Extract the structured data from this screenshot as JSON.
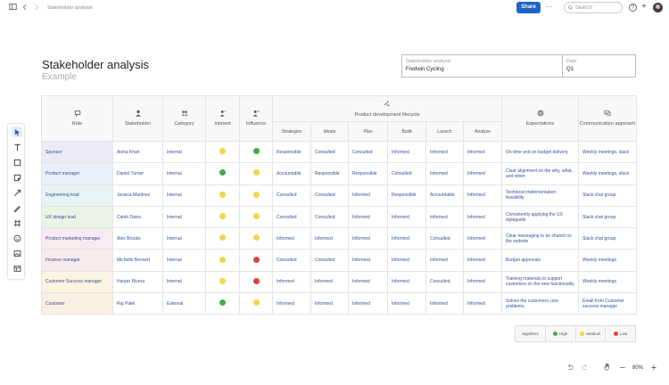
{
  "header": {
    "breadcrumb": "Stakeholder analysis",
    "share_label": "Share",
    "search_placeholder": "Search"
  },
  "document": {
    "title": "Stakeholder analysis",
    "subtitle": "Example",
    "meta": {
      "stakeholder_label": "Stakeholder analysis",
      "stakeholder_value": "Fredwin Cycling",
      "date_label": "Date",
      "date_value": "Q1"
    }
  },
  "table": {
    "headers": {
      "role": "Role",
      "stakeholder": "Stakeholder",
      "category": "Category",
      "interest": "Interest",
      "influence": "Influence",
      "lifecycle": "Product development lifecycle",
      "expectations": "Expectations",
      "communication": "Communication approach"
    },
    "phases": [
      "Strategize",
      "Ideate",
      "Plan",
      "Build",
      "Launch",
      "Analyze"
    ],
    "rows": [
      {
        "role": "Sponsor",
        "stakeholder": "Aisha Khan",
        "category": "Internal",
        "interest": "medium",
        "influence": "high",
        "phases": [
          "Responsible",
          "Consulted",
          "Consulted",
          "Informed",
          "Informed",
          "Informed"
        ],
        "expectations": "On-time and on budget delivery",
        "communication": "Weekly meetings, slack",
        "color": "#ecebf5"
      },
      {
        "role": "Product manager",
        "stakeholder": "Daniel Turner",
        "category": "Internal",
        "interest": "high",
        "influence": "medium",
        "phases": [
          "Accountable",
          "Responsible",
          "Responsible",
          "Consulted",
          "Informed",
          "Informed"
        ],
        "expectations": "Clear alignment on the why, what, and when",
        "communication": "Weekly meetings, slack",
        "color": "#e8f0fb"
      },
      {
        "role": "Engineering lead",
        "stakeholder": "Jessica Martinez",
        "category": "Internal",
        "interest": "medium",
        "influence": "medium",
        "phases": [
          "Consulted",
          "Consulted",
          "Informed",
          "Responsible",
          "Accountable",
          "Informed"
        ],
        "expectations": "Technical implementation feasibility",
        "communication": "Slack chat group",
        "color": "#e7f4f3"
      },
      {
        "role": "UX design lead",
        "stakeholder": "Caleb Davis",
        "category": "Internal",
        "interest": "medium",
        "influence": "medium",
        "phases": [
          "Consulted",
          "Consulted",
          "Informed",
          "Informed",
          "Informed",
          "Informed"
        ],
        "expectations": "Consistently applying the UX styleguide",
        "communication": "Slack chat group",
        "color": "#eaf3e6"
      },
      {
        "role": "Product marketing manager",
        "stakeholder": "Alex Brooks",
        "category": "Internal",
        "interest": "medium",
        "influence": "medium",
        "phases": [
          "Informed",
          "Informed",
          "Informed",
          "Informed",
          "Consulted",
          "Informed"
        ],
        "expectations": "Clear messaging to be shared on the website",
        "communication": "Slack chat group",
        "color": "#f6ecf2"
      },
      {
        "role": "Finance manager",
        "stakeholder": "Michelle Bennett",
        "category": "Internal",
        "interest": "medium",
        "influence": "low",
        "phases": [
          "Consulted",
          "Consulted",
          "Informed",
          "Informed",
          "Informed",
          "Informed"
        ],
        "expectations": "Budget approvals",
        "communication": "Weekly meetings",
        "color": "#f8ebeb"
      },
      {
        "role": "Customer Success manager",
        "stakeholder": "Harper Rivera",
        "category": "Internal",
        "interest": "medium",
        "influence": "low",
        "phases": [
          "Informed",
          "Informed",
          "Informed",
          "Informed",
          "Consulted",
          "Informed"
        ],
        "expectations": "Training materials to support customers on the new functionality",
        "communication": "Weekly meetings",
        "color": "#fbf4e3"
      },
      {
        "role": "Customer",
        "stakeholder": "Raj Patel",
        "category": "External",
        "interest": "high",
        "influence": "medium",
        "phases": [
          "Informed",
          "Informed",
          "Informed",
          "Informed",
          "Informed",
          "Informed"
        ],
        "expectations": "Solves the customers core problems",
        "communication": "Email from Customer success manager",
        "color": "#fbeee2"
      }
    ]
  },
  "legend": {
    "title": "Signifiers",
    "high": "High",
    "medium": "Medium",
    "low": "Low",
    "colors": {
      "high": "#3fae4a",
      "medium": "#f2d64a",
      "low": "#d9453b"
    }
  },
  "zoom": {
    "value": "80%"
  }
}
